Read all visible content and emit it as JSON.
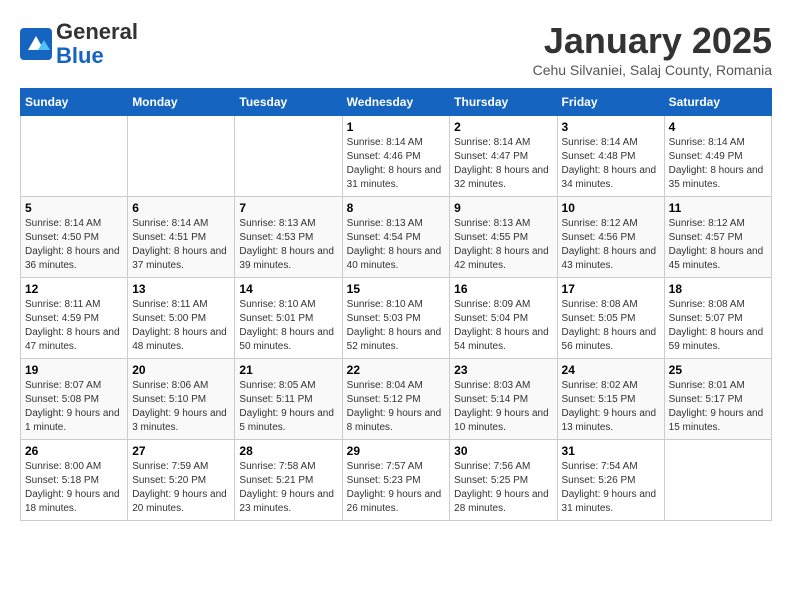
{
  "header": {
    "logo_general": "General",
    "logo_blue": "Blue",
    "month_title": "January 2025",
    "subtitle": "Cehu Silvaniei, Salaj County, Romania"
  },
  "days_of_week": [
    "Sunday",
    "Monday",
    "Tuesday",
    "Wednesday",
    "Thursday",
    "Friday",
    "Saturday"
  ],
  "weeks": [
    [
      {
        "day": "",
        "info": ""
      },
      {
        "day": "",
        "info": ""
      },
      {
        "day": "",
        "info": ""
      },
      {
        "day": "1",
        "info": "Sunrise: 8:14 AM\nSunset: 4:46 PM\nDaylight: 8 hours and 31 minutes."
      },
      {
        "day": "2",
        "info": "Sunrise: 8:14 AM\nSunset: 4:47 PM\nDaylight: 8 hours and 32 minutes."
      },
      {
        "day": "3",
        "info": "Sunrise: 8:14 AM\nSunset: 4:48 PM\nDaylight: 8 hours and 34 minutes."
      },
      {
        "day": "4",
        "info": "Sunrise: 8:14 AM\nSunset: 4:49 PM\nDaylight: 8 hours and 35 minutes."
      }
    ],
    [
      {
        "day": "5",
        "info": "Sunrise: 8:14 AM\nSunset: 4:50 PM\nDaylight: 8 hours and 36 minutes."
      },
      {
        "day": "6",
        "info": "Sunrise: 8:14 AM\nSunset: 4:51 PM\nDaylight: 8 hours and 37 minutes."
      },
      {
        "day": "7",
        "info": "Sunrise: 8:13 AM\nSunset: 4:53 PM\nDaylight: 8 hours and 39 minutes."
      },
      {
        "day": "8",
        "info": "Sunrise: 8:13 AM\nSunset: 4:54 PM\nDaylight: 8 hours and 40 minutes."
      },
      {
        "day": "9",
        "info": "Sunrise: 8:13 AM\nSunset: 4:55 PM\nDaylight: 8 hours and 42 minutes."
      },
      {
        "day": "10",
        "info": "Sunrise: 8:12 AM\nSunset: 4:56 PM\nDaylight: 8 hours and 43 minutes."
      },
      {
        "day": "11",
        "info": "Sunrise: 8:12 AM\nSunset: 4:57 PM\nDaylight: 8 hours and 45 minutes."
      }
    ],
    [
      {
        "day": "12",
        "info": "Sunrise: 8:11 AM\nSunset: 4:59 PM\nDaylight: 8 hours and 47 minutes."
      },
      {
        "day": "13",
        "info": "Sunrise: 8:11 AM\nSunset: 5:00 PM\nDaylight: 8 hours and 48 minutes."
      },
      {
        "day": "14",
        "info": "Sunrise: 8:10 AM\nSunset: 5:01 PM\nDaylight: 8 hours and 50 minutes."
      },
      {
        "day": "15",
        "info": "Sunrise: 8:10 AM\nSunset: 5:03 PM\nDaylight: 8 hours and 52 minutes."
      },
      {
        "day": "16",
        "info": "Sunrise: 8:09 AM\nSunset: 5:04 PM\nDaylight: 8 hours and 54 minutes."
      },
      {
        "day": "17",
        "info": "Sunrise: 8:08 AM\nSunset: 5:05 PM\nDaylight: 8 hours and 56 minutes."
      },
      {
        "day": "18",
        "info": "Sunrise: 8:08 AM\nSunset: 5:07 PM\nDaylight: 8 hours and 59 minutes."
      }
    ],
    [
      {
        "day": "19",
        "info": "Sunrise: 8:07 AM\nSunset: 5:08 PM\nDaylight: 9 hours and 1 minute."
      },
      {
        "day": "20",
        "info": "Sunrise: 8:06 AM\nSunset: 5:10 PM\nDaylight: 9 hours and 3 minutes."
      },
      {
        "day": "21",
        "info": "Sunrise: 8:05 AM\nSunset: 5:11 PM\nDaylight: 9 hours and 5 minutes."
      },
      {
        "day": "22",
        "info": "Sunrise: 8:04 AM\nSunset: 5:12 PM\nDaylight: 9 hours and 8 minutes."
      },
      {
        "day": "23",
        "info": "Sunrise: 8:03 AM\nSunset: 5:14 PM\nDaylight: 9 hours and 10 minutes."
      },
      {
        "day": "24",
        "info": "Sunrise: 8:02 AM\nSunset: 5:15 PM\nDaylight: 9 hours and 13 minutes."
      },
      {
        "day": "25",
        "info": "Sunrise: 8:01 AM\nSunset: 5:17 PM\nDaylight: 9 hours and 15 minutes."
      }
    ],
    [
      {
        "day": "26",
        "info": "Sunrise: 8:00 AM\nSunset: 5:18 PM\nDaylight: 9 hours and 18 minutes."
      },
      {
        "day": "27",
        "info": "Sunrise: 7:59 AM\nSunset: 5:20 PM\nDaylight: 9 hours and 20 minutes."
      },
      {
        "day": "28",
        "info": "Sunrise: 7:58 AM\nSunset: 5:21 PM\nDaylight: 9 hours and 23 minutes."
      },
      {
        "day": "29",
        "info": "Sunrise: 7:57 AM\nSunset: 5:23 PM\nDaylight: 9 hours and 26 minutes."
      },
      {
        "day": "30",
        "info": "Sunrise: 7:56 AM\nSunset: 5:25 PM\nDaylight: 9 hours and 28 minutes."
      },
      {
        "day": "31",
        "info": "Sunrise: 7:54 AM\nSunset: 5:26 PM\nDaylight: 9 hours and 31 minutes."
      },
      {
        "day": "",
        "info": ""
      }
    ]
  ]
}
